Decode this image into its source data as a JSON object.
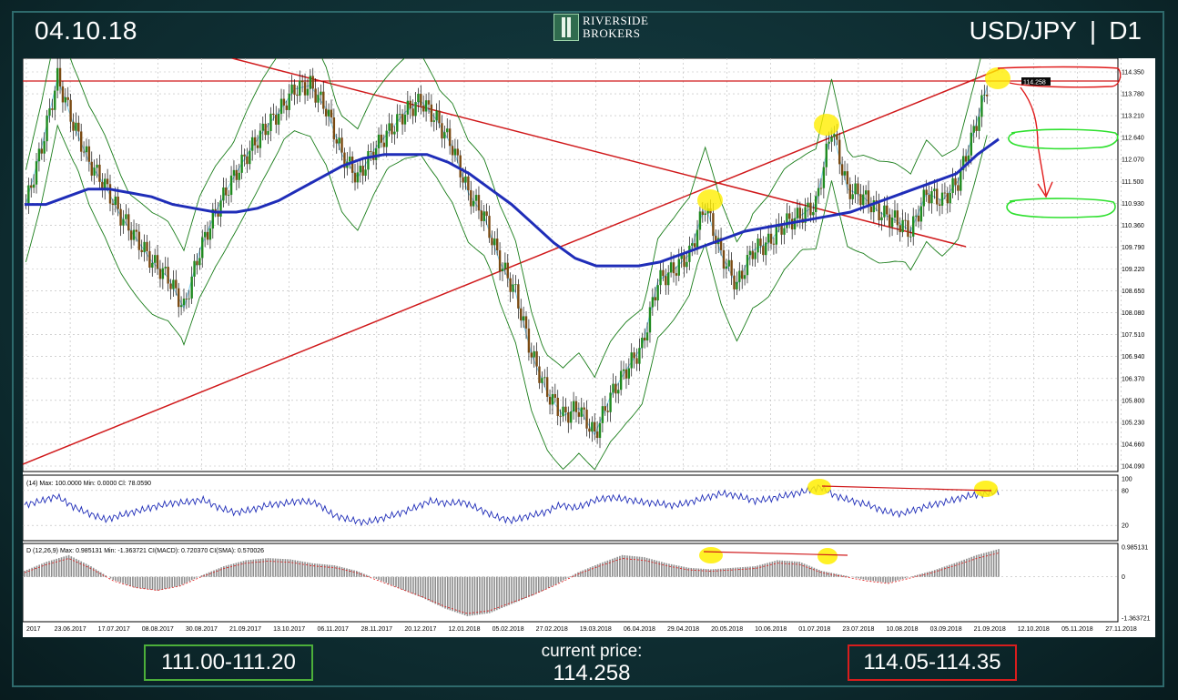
{
  "header": {
    "date": "04.10.18",
    "symbol": "USD/JPY",
    "timeframe": "D1",
    "logo_line1": "RIVERSIDE",
    "logo_line2": "BROKERS"
  },
  "footer": {
    "support_range": "111.00-111.20",
    "current_price_label": "current price:",
    "current_price": "114.258",
    "resistance_range": "114.05-114.35"
  },
  "chart_data": [
    {
      "type": "candlestick",
      "ylim": [
        104.09,
        114.35
      ],
      "yticks": [
        "114.350",
        "113.780",
        "113.210",
        "112.640",
        "112.070",
        "111.500",
        "110.930",
        "110.360",
        "109.790",
        "109.220",
        "108.650",
        "108.080",
        "107.510",
        "106.940",
        "106.370",
        "105.800",
        "105.230",
        "104.660",
        "104.090"
      ],
      "current_price_tag": "114.258",
      "xticks": [
        "2017",
        "23.06.2017",
        "17.07.2017",
        "08.08.2017",
        "30.08.2017",
        "21.09.2017",
        "13.10.2017",
        "06.11.2017",
        "28.11.2017",
        "20.12.2017",
        "12.01.2018",
        "05.02.2018",
        "27.02.2018",
        "19.03.2018",
        "06.04.2018",
        "29.04.2018",
        "20.05.2018",
        "10.06.2018",
        "01.07.2018",
        "23.07.2018",
        "10.08.2018",
        "03.09.2018",
        "21.09.2018",
        "12.10.2018",
        "05.11.2018",
        "27.11.2018"
      ],
      "series": [
        {
          "name": "",
          "values": [
            110.9,
            112.4,
            114.2,
            113.0,
            112.0,
            111.4,
            110.6,
            110.0,
            109.4,
            109.0,
            108.2,
            109.7,
            110.7,
            111.5,
            112.2,
            112.8,
            113.3,
            113.9,
            114.0,
            113.4,
            112.2,
            111.6,
            112.3,
            112.8,
            113.3,
            113.6,
            113.1,
            112.4,
            111.2,
            110.6,
            109.4,
            108.6,
            107.0,
            106.0,
            105.4,
            105.6,
            104.9,
            105.9,
            106.6,
            107.2,
            108.9,
            109.2,
            109.6,
            110.9,
            109.6,
            108.8,
            109.7,
            109.9,
            110.4,
            110.6,
            110.9,
            112.9,
            111.3,
            111.1,
            110.7,
            110.5,
            110.2,
            111.2,
            111.0,
            111.5,
            112.8,
            114.2
          ]
        },
        {
          "name": "",
          "values": [
            110.9,
            110.9,
            111.1,
            111.3,
            111.3,
            111.2,
            111.1,
            110.9,
            110.8,
            110.7,
            110.7,
            110.8,
            111.0,
            111.3,
            111.6,
            111.9,
            112.1,
            112.2,
            112.2,
            112.2,
            112.0,
            111.7,
            111.3,
            110.9,
            110.4,
            109.9,
            109.5,
            109.3,
            109.3,
            109.3,
            109.4,
            109.6,
            109.8,
            110.0,
            110.2,
            110.3,
            110.4,
            110.5,
            110.6,
            110.7,
            110.9,
            111.1,
            111.3,
            111.5,
            111.7,
            112.2,
            112.6
          ]
        }
      ]
    },
    {
      "type": "line",
      "label": "(14) Max: 100.0000  Min: 0.0000  Cl: 78.0590",
      "ylim": [
        0,
        100
      ],
      "yticks": [
        "100",
        "80",
        "20"
      ],
      "series": [
        {
          "name": "",
          "values": [
            55,
            62,
            70,
            52,
            40,
            30,
            38,
            45,
            52,
            58,
            60,
            64,
            50,
            42,
            47,
            55,
            58,
            62,
            58,
            38,
            30,
            25,
            32,
            40,
            50,
            62,
            58,
            60,
            48,
            35,
            28,
            36,
            42,
            55,
            50,
            62,
            68,
            65,
            60,
            58,
            54,
            60,
            68,
            75,
            70,
            62,
            66,
            72,
            78,
            86,
            70,
            62,
            55,
            44,
            40,
            48,
            56,
            62,
            70,
            74,
            78
          ]
        }
      ]
    },
    {
      "type": "bar",
      "label": "D (12,26,9)  Max: 0.985131  Min: -1.363721  CI(MACD): 0.720370  CI(SMA): 0.570026",
      "ylim": [
        -1.363721,
        0.985131
      ],
      "yticks": [
        "0.985131",
        "0",
        "-1.363721"
      ],
      "values": [
        0.2,
        0.5,
        0.72,
        0.35,
        -0.1,
        -0.35,
        -0.45,
        -0.3,
        0.05,
        0.35,
        0.55,
        0.62,
        0.58,
        0.45,
        0.38,
        0.2,
        -0.1,
        -0.4,
        -0.7,
        -1.05,
        -1.3,
        -1.2,
        -0.9,
        -0.6,
        -0.25,
        0.15,
        0.45,
        0.72,
        0.65,
        0.45,
        0.3,
        0.25,
        0.3,
        0.35,
        0.55,
        0.5,
        0.2,
        0.05,
        -0.1,
        -0.2,
        0.0,
        0.2,
        0.45,
        0.72,
        0.92
      ]
    }
  ]
}
